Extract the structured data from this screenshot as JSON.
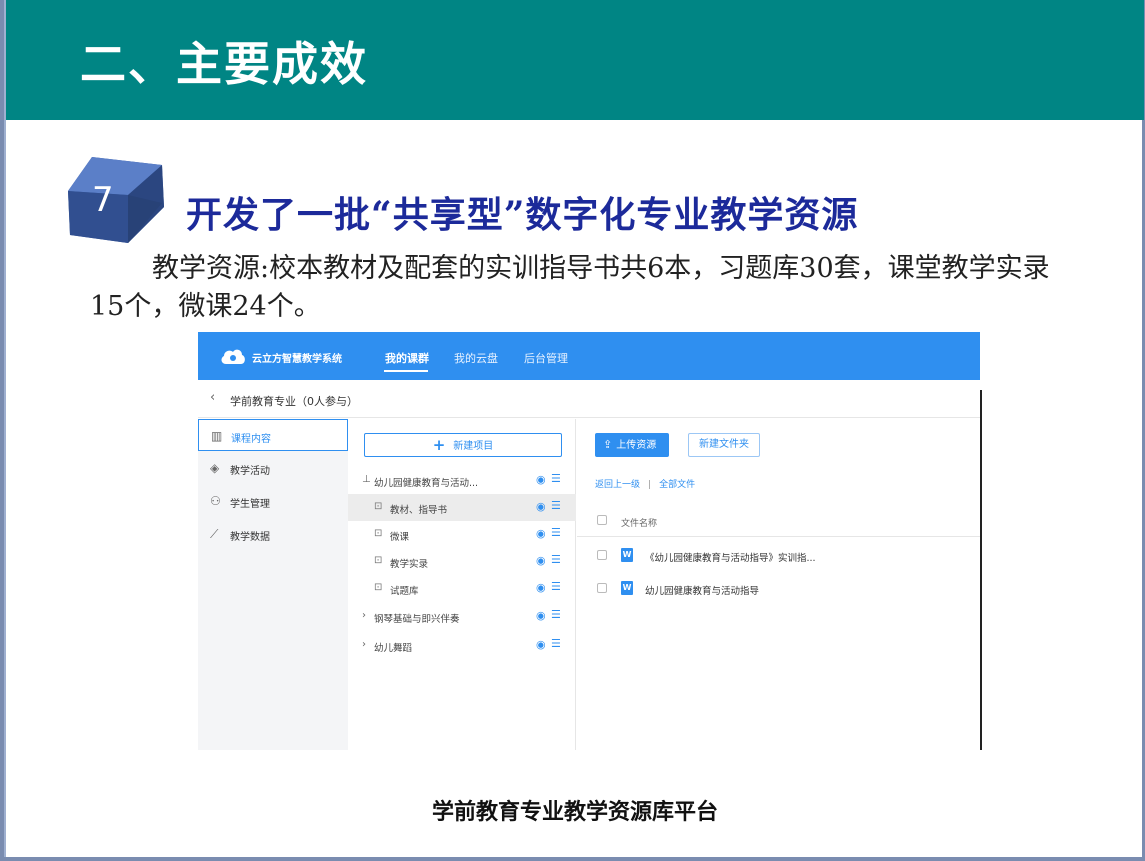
{
  "slide": {
    "title": "二、主要成效",
    "badge_number": "7",
    "headline": "开发了一批“共享型”数字化专业教学资源",
    "paragraph": "教学资源:校本教材及配套的实训指导书共6本，习题库30套，课堂教学实录15个，微课24个。",
    "caption": "学前教育专业教学资源库平台",
    "colors": {
      "title_bar": "#008584",
      "headline": "#1c2a9a",
      "app_primary": "#2f8ff0"
    }
  },
  "app": {
    "brand": "云立方智慧教学系统",
    "nav": [
      {
        "label": "我的课群",
        "active": true
      },
      {
        "label": "我的云盘",
        "active": false
      },
      {
        "label": "后台管理",
        "active": false
      }
    ],
    "breadcrumb": {
      "back_icon": "chevron-left-icon",
      "text": "学前教育专业（0人参与）"
    },
    "sidebar": [
      {
        "label": "课程内容",
        "icon": "books-icon",
        "active": true
      },
      {
        "label": "教学活动",
        "icon": "tag-icon",
        "active": false
      },
      {
        "label": "学生管理",
        "icon": "users-icon",
        "active": false
      },
      {
        "label": "教学数据",
        "icon": "trend-icon",
        "active": false
      }
    ],
    "tree": {
      "new_button": "新建项目",
      "rows": [
        {
          "label": "幼儿园健康教育与活动...",
          "level": 0,
          "caret": "⊥",
          "selected": false
        },
        {
          "label": "教材、指导书",
          "level": 1,
          "selected": true
        },
        {
          "label": "微课",
          "level": 1,
          "selected": false
        },
        {
          "label": "教学实录",
          "level": 1,
          "selected": false
        },
        {
          "label": "试题库",
          "level": 1,
          "selected": false
        },
        {
          "label": "钢琴基础与即兴伴奏",
          "level": 0,
          "caret": "›",
          "selected": false
        },
        {
          "label": "幼儿舞蹈",
          "level": 0,
          "caret": "›",
          "selected": false
        }
      ]
    },
    "files": {
      "upload_button": "上传资源",
      "new_folder_button": "新建文件夹",
      "link_up": "返回上一级",
      "link_separator": "|",
      "link_all": "全部文件",
      "column_header": "文件名称",
      "rows": [
        {
          "name": "《幼儿园健康教育与活动指导》实训指...",
          "type_badge": "W"
        },
        {
          "name": "幼儿园健康教育与活动指导",
          "type_badge": "W"
        }
      ]
    }
  }
}
